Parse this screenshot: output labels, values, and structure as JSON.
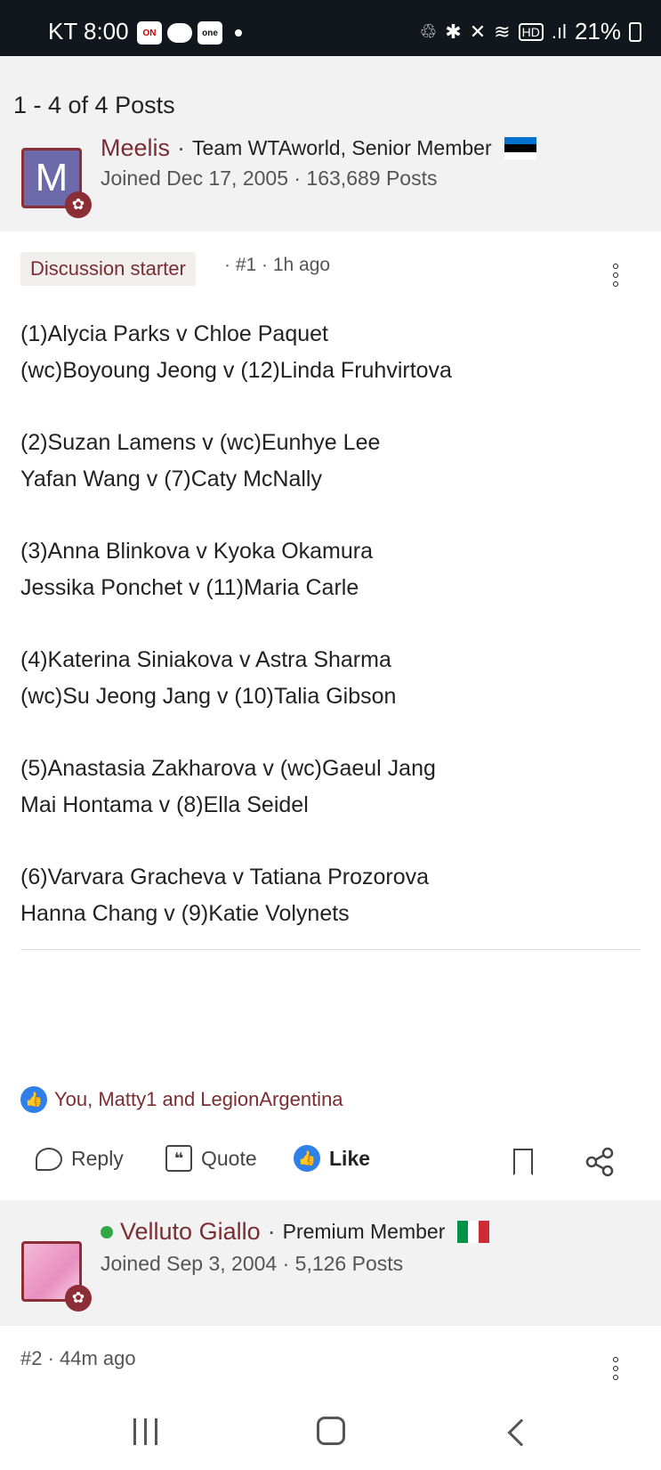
{
  "status_bar": {
    "time": "KT 8:00",
    "badge_on": "ON",
    "badge_one": "one",
    "battery": "21%"
  },
  "thread": {
    "post_count": "1 - 4 of 4 Posts"
  },
  "posts": [
    {
      "author": {
        "avatar_letter": "M",
        "name": "Meelis",
        "separator": "·",
        "role": "Team WTAworld, Senior Member",
        "joined": "Joined Dec 17, 2005 · 163,689 Posts",
        "flag": "estonia-flag"
      },
      "tag": "Discussion starter",
      "meta": "· #1 · 1h ago",
      "lines": [
        "(1)Alycia Parks v Chloe Paquet",
        "(wc)Boyoung Jeong v (12)Linda Fruhvirtova",
        "(2)Suzan Lamens v (wc)Eunhye Lee",
        "Yafan Wang v (7)Caty McNally",
        "(3)Anna Blinkova v Kyoka Okamura",
        "Jessika Ponchet v (11)Maria Carle",
        "(4)Katerina Siniakova v Astra Sharma",
        "(wc)Su Jeong Jang v (10)Talia Gibson",
        "(5)Anastasia Zakharova v (wc)Gaeul Jang",
        "Mai Hontama v (8)Ella Seidel",
        "(6)Varvara Gracheva v Tatiana Prozorova",
        "Hanna Chang v (9)Katie Volynets"
      ],
      "likes_text": "You, Matty1 and LegionArgentina",
      "actions": {
        "reply": "Reply",
        "quote": "Quote",
        "like": "Like"
      }
    },
    {
      "author": {
        "name": "Velluto Giallo",
        "separator": "·",
        "role": "Premium Member",
        "joined": "Joined Sep 3, 2004 · 5,126 Posts",
        "flag": "italy-flag"
      },
      "meta": "#2 · 44m ago"
    }
  ],
  "colors": {
    "accent": "#7a2d33",
    "like_blue": "#2f80e8",
    "online": "#35a645",
    "header_bg": "#f2f2f2"
  }
}
